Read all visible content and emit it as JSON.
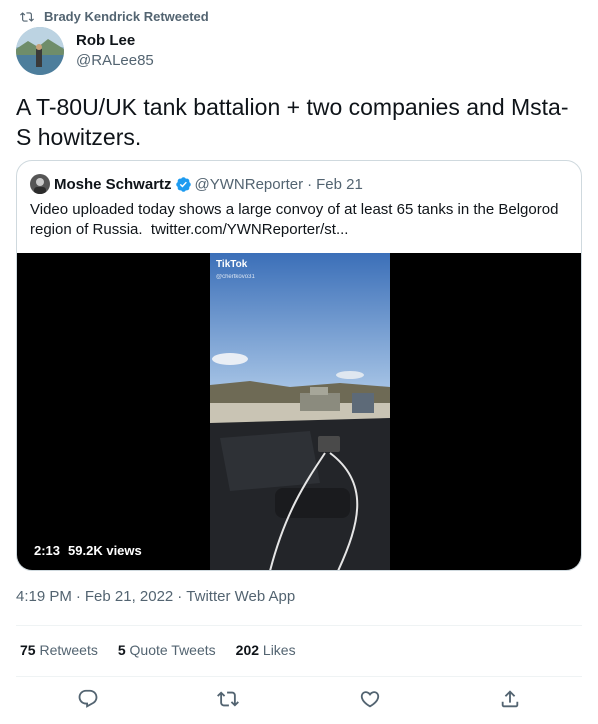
{
  "retweet_context": {
    "text": "Brady Kendrick Retweeted",
    "icon": "retweet-icon"
  },
  "author": {
    "display_name": "Rob Lee",
    "handle": "@RALee85"
  },
  "tweet": {
    "text": "A T-80U/UK tank battalion + two companies and Msta-S howitzers."
  },
  "quoted_tweet": {
    "display_name": "Moshe Schwartz",
    "verified": true,
    "handle": "@YWNReporter",
    "separator": "·",
    "date": "Feb 21",
    "text": "Video uploaded today shows a large convoy of at least 65 tanks in the Belgorod region of Russia.",
    "link": "twitter.com/YWNReporter/st...",
    "video": {
      "watermark": "TikTok",
      "watermark_sub": "@chertkovo31",
      "duration": "2:13",
      "views": "59.2K views"
    }
  },
  "meta": {
    "time": "4:19 PM",
    "separator": "·",
    "date": "Feb 21, 2022",
    "source": "Twitter Web App"
  },
  "stats": {
    "retweets_count": "75",
    "retweets_label": "Retweets",
    "quotes_count": "5",
    "quotes_label": "Quote Tweets",
    "likes_count": "202",
    "likes_label": "Likes"
  },
  "actions": [
    "reply-icon",
    "retweet-icon",
    "like-icon",
    "share-icon"
  ],
  "colors": {
    "text": "#0f1419",
    "secondary": "#536471",
    "border": "#cfd9de",
    "verified": "#1d9bf0"
  }
}
